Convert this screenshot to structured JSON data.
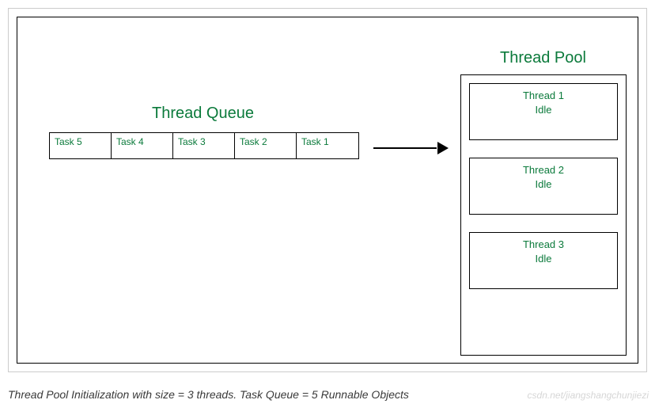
{
  "queue": {
    "title": "Thread Queue",
    "tasks": [
      "Task 5",
      "Task 4",
      "Task 3",
      "Task 2",
      "Task 1"
    ]
  },
  "pool": {
    "title": "Thread Pool",
    "threads": [
      {
        "name": "Thread 1",
        "status": "Idle"
      },
      {
        "name": "Thread 2",
        "status": "Idle"
      },
      {
        "name": "Thread 3",
        "status": "Idle"
      }
    ]
  },
  "caption": "Thread Pool Initialization with size = 3 threads. Task Queue = 5 Runnable Objects",
  "watermark": "csdn.net/jiangshangchunjiezi"
}
